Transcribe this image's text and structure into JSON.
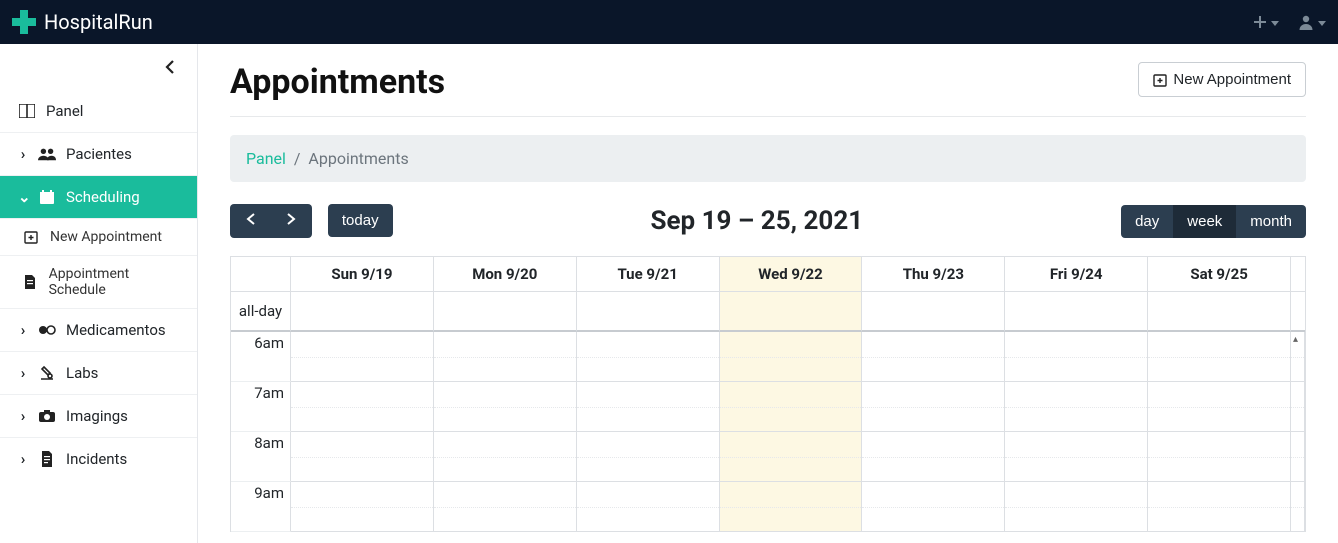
{
  "brand": "HospitalRun",
  "sidebar": {
    "panel": "Panel",
    "items": [
      {
        "label": "Pacientes"
      },
      {
        "label": "Scheduling",
        "active": true,
        "children": [
          {
            "label": "New Appointment"
          },
          {
            "label": "Appointment Schedule"
          }
        ]
      },
      {
        "label": "Medicamentos"
      },
      {
        "label": "Labs"
      },
      {
        "label": "Imagings"
      },
      {
        "label": "Incidents"
      }
    ]
  },
  "page": {
    "title": "Appointments",
    "new_btn": "New Appointment"
  },
  "breadcrumb": {
    "root": "Panel",
    "sep": "/",
    "current": "Appointments"
  },
  "calendar": {
    "today_btn": "today",
    "title": "Sep 19 – 25, 2021",
    "views": {
      "day": "day",
      "week": "week",
      "month": "month"
    },
    "active_view": "week",
    "days": [
      "Sun 9/19",
      "Mon 9/20",
      "Tue 9/21",
      "Wed 9/22",
      "Thu 9/23",
      "Fri 9/24",
      "Sat 9/25"
    ],
    "today_index": 3,
    "allday_label": "all-day",
    "hours": [
      "6am",
      "7am",
      "8am",
      "9am"
    ]
  }
}
